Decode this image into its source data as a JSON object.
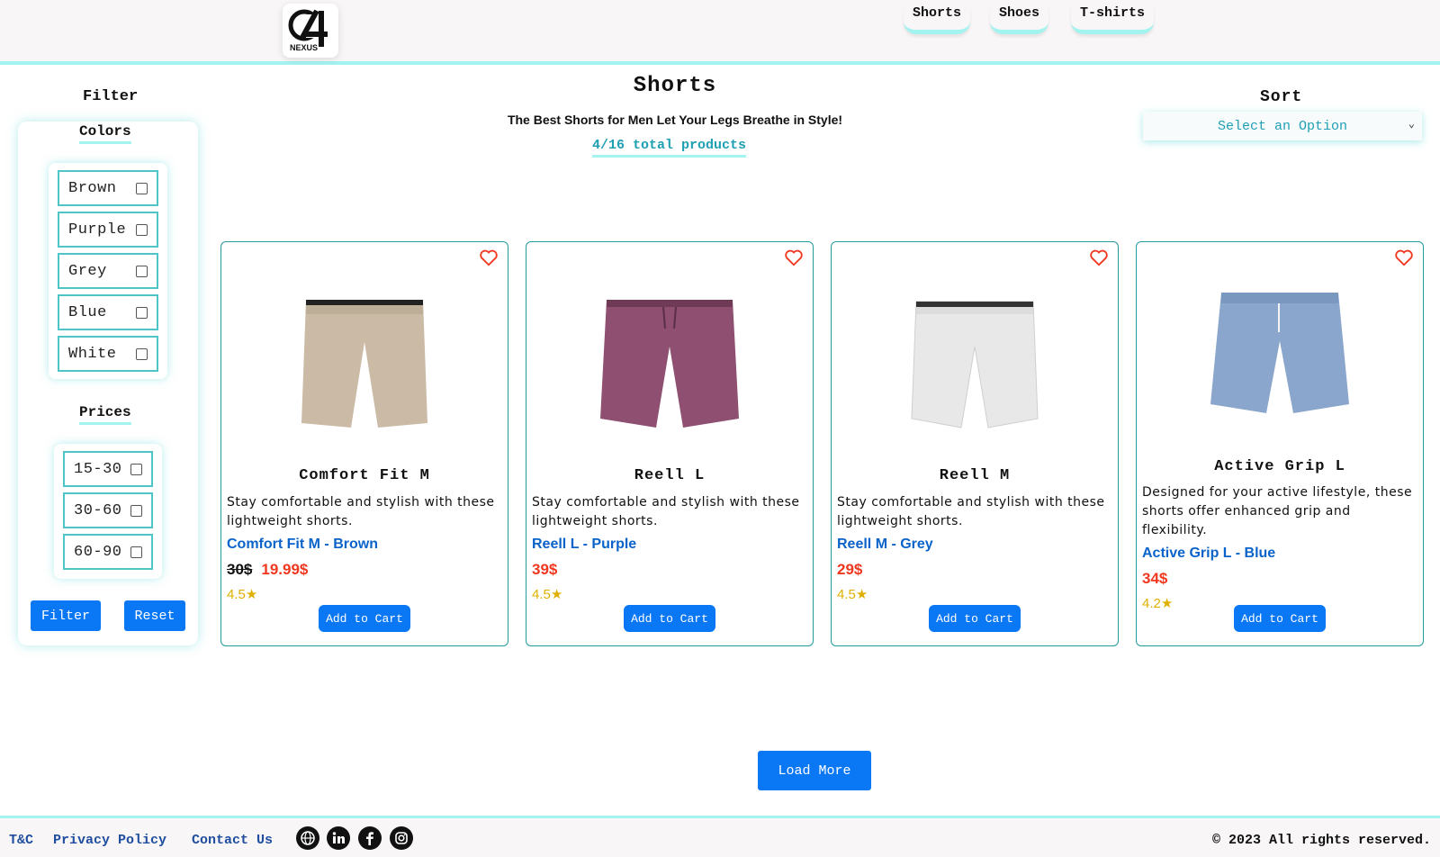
{
  "header": {
    "logo": {
      "text": "C4",
      "subtext": "NEXUS"
    },
    "nav": [
      {
        "label": "Shorts"
      },
      {
        "label": "Shoes"
      },
      {
        "label": "T-shirts"
      }
    ]
  },
  "filter": {
    "title": "Filter",
    "colors_heading": "Colors",
    "colors": [
      "Brown",
      "Purple",
      "Grey",
      "Blue",
      "White"
    ],
    "prices_heading": "Prices",
    "prices": [
      "15-30",
      "30-60",
      "60-90"
    ],
    "filter_button": "Filter",
    "reset_button": "Reset"
  },
  "main": {
    "title": "Shorts",
    "subtitle": "The Best Shorts for Men Let Your Legs Breathe in Style!",
    "count": "4/16 total products"
  },
  "sort": {
    "title": "Sort",
    "selected": "Select an Option"
  },
  "products": [
    {
      "name": "Comfort Fit M",
      "description": "Stay comfortable and stylish with these lightweight shorts.",
      "link": "Comfort Fit M - Brown",
      "old_price": "30$",
      "price": "19.99$",
      "rating": "4.5★",
      "cart": "Add to Cart",
      "color": "#cbbba6"
    },
    {
      "name": "Reell L",
      "description": "Stay comfortable and stylish with these lightweight shorts.",
      "link": "Reell L - Purple",
      "old_price": "",
      "price": "39$",
      "rating": "4.5★",
      "cart": "Add to Cart",
      "color": "#8e4f70"
    },
    {
      "name": "Reell M",
      "description": "Stay comfortable and stylish with these lightweight shorts.",
      "link": "Reell M - Grey",
      "old_price": "",
      "price": "29$",
      "rating": "4.5★",
      "cart": "Add to Cart",
      "color": "#e6e6e6"
    },
    {
      "name": "Active Grip L",
      "description": "Designed for your active lifestyle, these shorts offer enhanced grip and flexibility.",
      "link": "Active Grip L - Blue",
      "old_price": "",
      "price": "34$",
      "rating": "4.2★",
      "cart": "Add to Cart",
      "color": "#8aa6cc"
    }
  ],
  "load_more": "Load More",
  "footer": {
    "links": [
      "T&C",
      "Privacy Policy",
      "Contact Us"
    ],
    "social_icons": [
      "globe-icon",
      "linkedin-icon",
      "facebook-icon",
      "instagram-icon"
    ],
    "copyright": "© 2023 All rights reserved."
  }
}
